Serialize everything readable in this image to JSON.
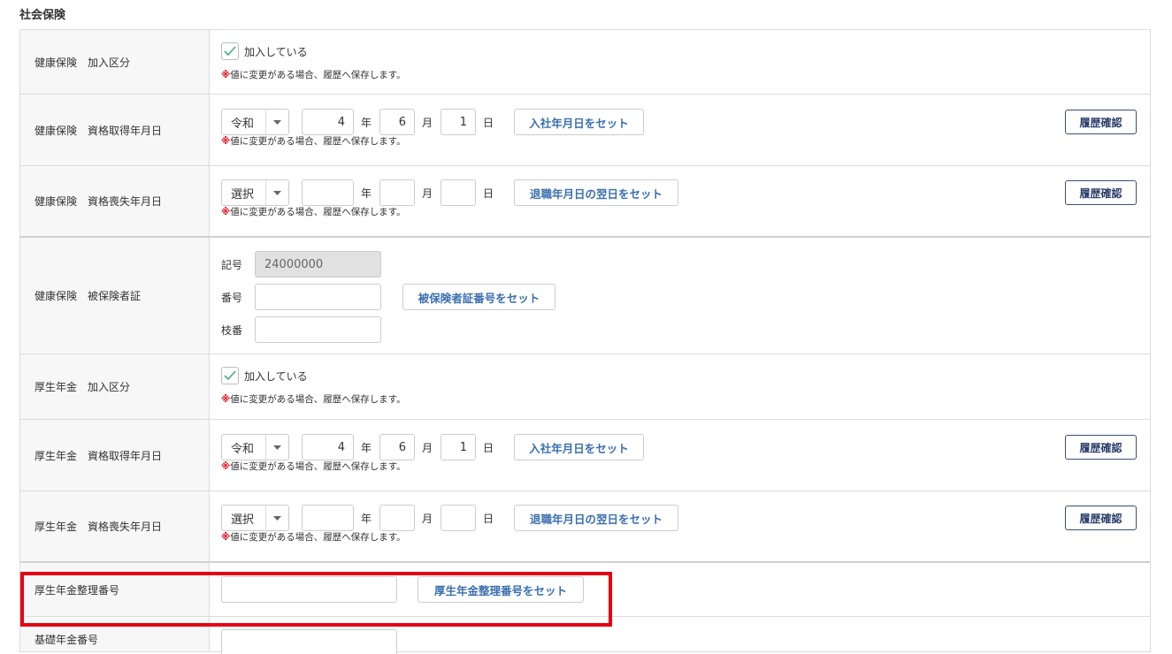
{
  "section_title": "社会保険",
  "note_mark": "※",
  "note_text": "値に変更がある場合、履歴へ保存します。",
  "history_button": "履歴確認",
  "unit_year": "年",
  "unit_month": "月",
  "unit_day": "日",
  "rows": {
    "kenpo_enroll": {
      "label": "健康保険　加入区分",
      "check_label": "加入している",
      "checked": true
    },
    "kenpo_acquire": {
      "label": "健康保険　資格取得年月日",
      "era": "令和",
      "year": "4",
      "month": "6",
      "day": "1",
      "set_button": "入社年月日をセット"
    },
    "kenpo_loss": {
      "label": "健康保険　資格喪失年月日",
      "era": "選択",
      "year": "",
      "month": "",
      "day": "",
      "set_button": "退職年月日の翌日をセット"
    },
    "kenpo_card": {
      "label": "健康保険　被保険者証",
      "symbol_label": "記号",
      "symbol_value": "24000000",
      "number_label": "番号",
      "number_value": "",
      "branch_label": "枝番",
      "branch_value": "",
      "set_button": "被保険者証番号をセット"
    },
    "kosei_enroll": {
      "label": "厚生年金　加入区分",
      "check_label": "加入している",
      "checked": true
    },
    "kosei_acquire": {
      "label": "厚生年金　資格取得年月日",
      "era": "令和",
      "year": "4",
      "month": "6",
      "day": "1",
      "set_button": "入社年月日をセット"
    },
    "kosei_loss": {
      "label": "厚生年金　資格喪失年月日",
      "era": "選択",
      "year": "",
      "month": "",
      "day": "",
      "set_button": "退職年月日の翌日をセット"
    },
    "kosei_number": {
      "label": "厚生年金整理番号",
      "value": "",
      "set_button": "厚生年金整理番号をセット"
    },
    "basic_pension": {
      "label": "基礎年金番号",
      "value": ""
    }
  },
  "colors": {
    "accent_button_text": "#3a6fb0",
    "history_border": "#3a4d78",
    "check_green": "#3cb371",
    "note_mark": "#e60012",
    "highlight": "#e60012"
  }
}
